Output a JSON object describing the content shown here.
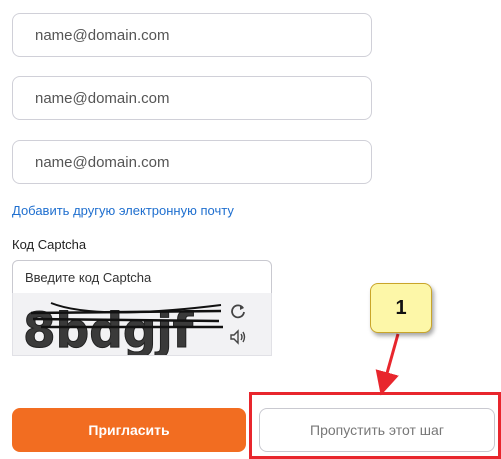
{
  "form": {
    "email_placeholders": [
      "name@domain.com",
      "name@domain.com",
      "name@domain.com"
    ],
    "add_email_link": "Добавить другую электронную почту",
    "captcha_label": "Код Captcha",
    "captcha_placeholder": "Введите код Captcha",
    "captcha_image_text": "8bdgjf",
    "refresh_icon": "refresh-icon",
    "audio_icon": "speaker-icon"
  },
  "buttons": {
    "invite_label": "Пригласить",
    "skip_label": "Пропустить этот шаг"
  },
  "annotation": {
    "callout_number": "1",
    "highlight_color": "#e8262d",
    "callout_color": "#fdf7a8"
  },
  "colors": {
    "primary": "#f26d21",
    "link": "#1f6fcf"
  }
}
